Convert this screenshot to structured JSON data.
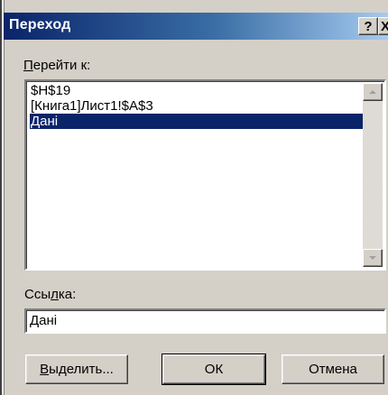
{
  "dialog": {
    "title": "Переход",
    "help_button": "?",
    "close_button": "X"
  },
  "goto_label": {
    "accel": "П",
    "rest": "ерейти к:"
  },
  "list": {
    "items": [
      {
        "text": "$H$19",
        "selected": false
      },
      {
        "text": "[Книга1]Лист1!$A$3",
        "selected": false
      },
      {
        "text": "Дані",
        "selected": true
      }
    ]
  },
  "reference_label": {
    "before": "Ссы",
    "accel": "л",
    "after": "ка:"
  },
  "reference_value": "Дані",
  "buttons": {
    "select": {
      "accel": "В",
      "rest": "ыделить..."
    },
    "ok": "ОК",
    "cancel": "Отмена"
  }
}
